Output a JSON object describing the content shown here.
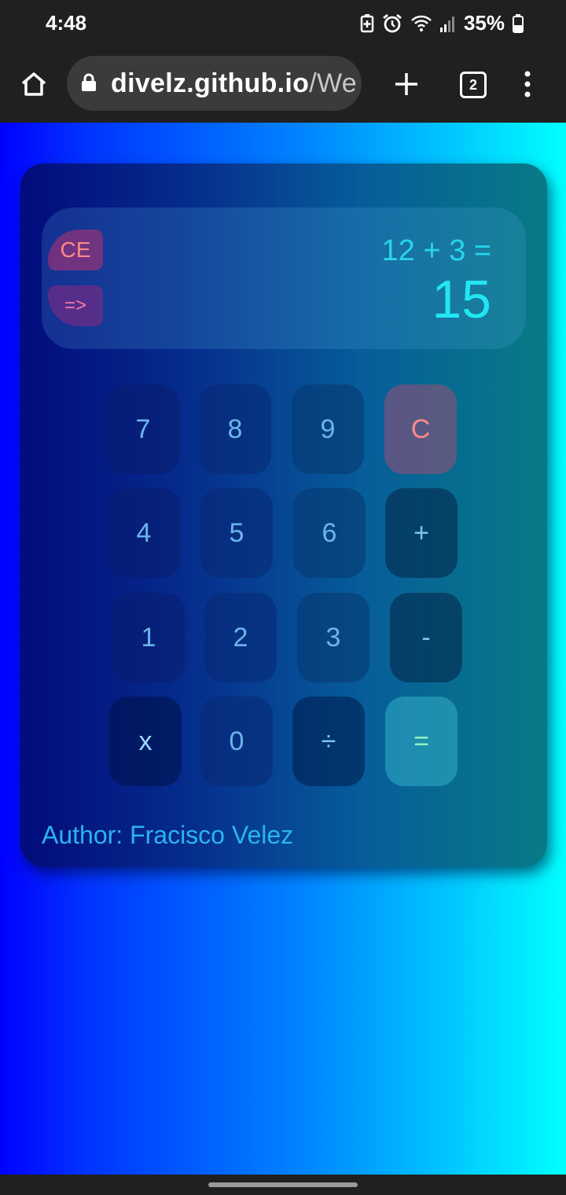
{
  "status_bar": {
    "time": "4:48",
    "battery_percent": "35%",
    "icons": [
      "battery-saver-icon",
      "alarm-icon",
      "wifi-icon",
      "signal-icon",
      "battery-icon"
    ]
  },
  "browser": {
    "url_host": "divelz.github.io",
    "url_path": "/We",
    "tab_count": "2",
    "icons": [
      "home-icon",
      "lock-icon",
      "new-tab-icon",
      "tabs-icon",
      "more-menu-icon"
    ]
  },
  "calculator": {
    "ce_label": "CE",
    "arrow_label": "=>",
    "expression": "12 + 3 =",
    "result": "15",
    "keys": [
      {
        "label": "7",
        "kind": "digit"
      },
      {
        "label": "8",
        "kind": "digit"
      },
      {
        "label": "9",
        "kind": "digit"
      },
      {
        "label": "C",
        "kind": "clear"
      },
      {
        "label": "4",
        "kind": "digit"
      },
      {
        "label": "5",
        "kind": "digit"
      },
      {
        "label": "6",
        "kind": "digit"
      },
      {
        "label": "+",
        "kind": "operator"
      },
      {
        "label": "1",
        "kind": "digit"
      },
      {
        "label": "2",
        "kind": "digit"
      },
      {
        "label": "3",
        "kind": "digit"
      },
      {
        "label": "-",
        "kind": "operator"
      },
      {
        "label": "x",
        "kind": "operator"
      },
      {
        "label": "0",
        "kind": "digit"
      },
      {
        "label": "÷",
        "kind": "operator"
      },
      {
        "label": "=",
        "kind": "equals"
      }
    ],
    "author": "Author: Fracisco Velez"
  },
  "colors": {
    "page_gradient_start": "#0000ff",
    "page_gradient_end": "#00ffff",
    "display_text": "#22e6f4",
    "clear_text": "#ff8a8a",
    "equals_text": "#8ff5c0"
  }
}
